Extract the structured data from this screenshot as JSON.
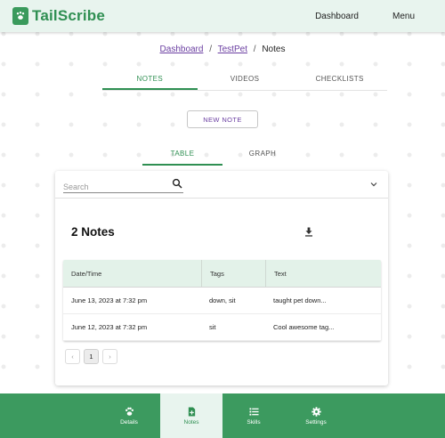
{
  "header": {
    "app_name": "TailScribe",
    "nav": {
      "dashboard": "Dashboard",
      "menu": "Menu"
    }
  },
  "breadcrumb": {
    "dashboard": "Dashboard",
    "pet": "TestPet",
    "current": "Notes",
    "separator": "/"
  },
  "main_tabs": [
    {
      "label": "NOTES",
      "active": true
    },
    {
      "label": "VIDEOS",
      "active": false
    },
    {
      "label": "CHECKLISTS",
      "active": false
    }
  ],
  "new_note_label": "NEW NOTE",
  "view_tabs": [
    {
      "label": "TABLE",
      "active": true
    },
    {
      "label": "GRAPH",
      "active": false
    }
  ],
  "search": {
    "placeholder": "Search",
    "value": ""
  },
  "notes_title": "2 Notes",
  "table": {
    "columns": [
      "Date/Time",
      "Tags",
      "Text"
    ],
    "rows": [
      [
        "June 13, 2023 at 7:32 pm",
        "down, sit",
        "taught pet down..."
      ],
      [
        "June 12, 2023 at 7:32 pm",
        "sit",
        "Cool awesome tag..."
      ]
    ]
  },
  "pagination": {
    "prev": "‹",
    "current_page": "1",
    "next": "›"
  },
  "bottom_nav": [
    {
      "label": "Details",
      "icon": "paw-icon",
      "active": false
    },
    {
      "label": "Notes",
      "icon": "note-add-icon",
      "active": true
    },
    {
      "label": "Skills",
      "icon": "list-icon",
      "active": false
    },
    {
      "label": "Settings",
      "icon": "gear-icon",
      "active": false
    }
  ],
  "colors": {
    "brand_green": "#3c9a5f",
    "header_bg": "#e8f4ee",
    "table_header_bg": "#e3f2e9",
    "link_purple": "#6a3ea1"
  }
}
